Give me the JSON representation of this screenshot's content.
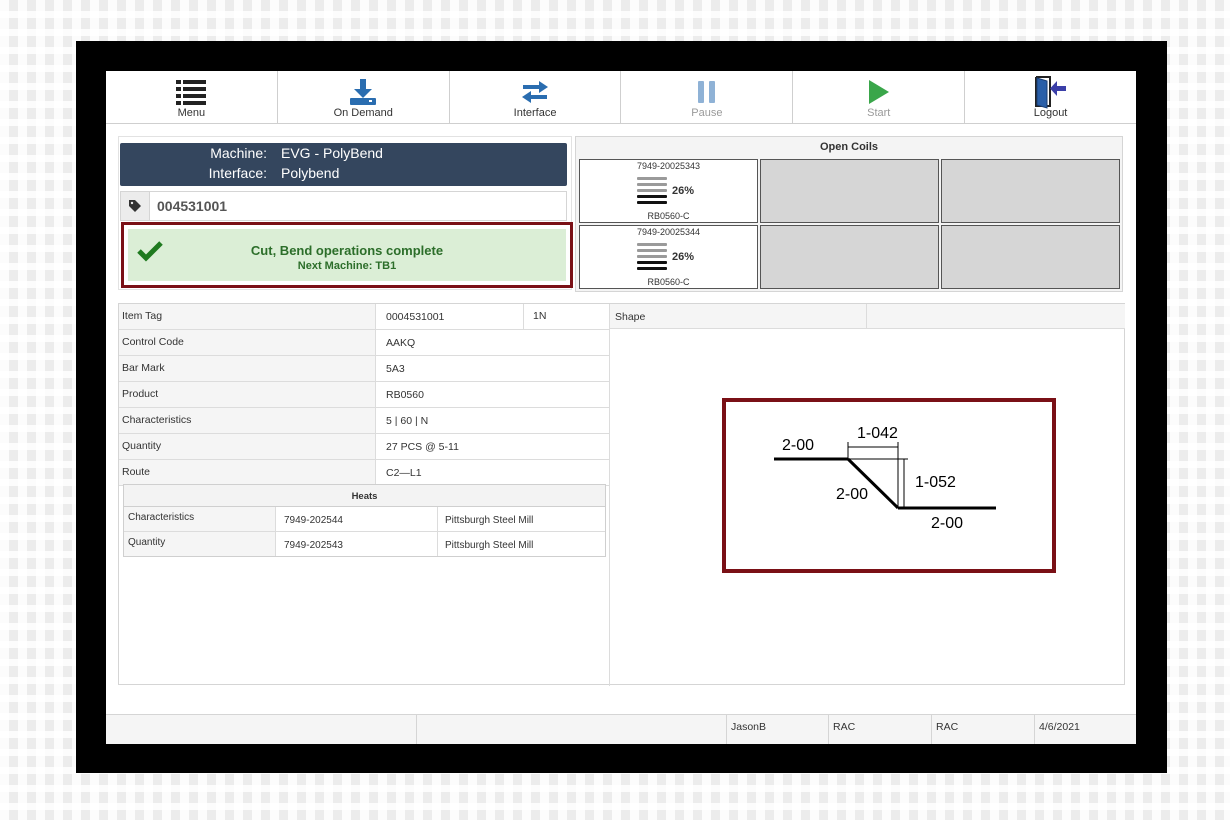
{
  "toolbar": {
    "menu": "Menu",
    "on_demand": "On Demand",
    "interface": "Interface",
    "pause": "Pause",
    "start": "Start",
    "logout": "Logout"
  },
  "machine": {
    "machine_label": "Machine:",
    "machine_value": "EVG - PolyBend",
    "interface_label": "Interface:",
    "interface_value": "Polybend"
  },
  "tag_number": "004531001",
  "status": {
    "title": "Cut, Bend operations complete",
    "subtitle": "Next Machine: TB1",
    "color": "#2c6e2a"
  },
  "open_coils": {
    "title": "Open Coils",
    "coils": [
      {
        "id": "7949-20025343",
        "percent": "26%",
        "product": "RB0560-C"
      },
      {
        "id": "7949-20025344",
        "percent": "26%",
        "product": "RB0560-C"
      }
    ]
  },
  "details": {
    "rows": [
      {
        "label": "Item Tag",
        "value": "0004531001",
        "extra": "1N"
      },
      {
        "label": "Control Code",
        "value": "AAKQ"
      },
      {
        "label": "Bar Mark",
        "value": "5A3"
      },
      {
        "label": "Product",
        "value": "RB0560"
      },
      {
        "label": "Characteristics",
        "value": "5 | 60 | N"
      },
      {
        "label": "Quantity",
        "value": "27 PCS @ 5-11"
      },
      {
        "label": "Route",
        "value": "C2—L1"
      }
    ],
    "shape_label": "Shape"
  },
  "heats": {
    "title": "Heats",
    "rows": [
      {
        "label": "Characteristics",
        "heat": "7949-202544",
        "mill": "Pittsburgh Steel Mill"
      },
      {
        "label": "Quantity",
        "heat": "7949-202543",
        "mill": "Pittsburgh Steel Mill"
      }
    ]
  },
  "shape": {
    "dim_left": "2-00",
    "dim_top": "1-042",
    "dim_right_vertical": "1-052",
    "dim_diagonal": "2-00",
    "dim_bottom": "2-00"
  },
  "footer": {
    "user": "JasonB",
    "field1": "RAC",
    "field2": "RAC",
    "date": "4/6/2021"
  },
  "colors": {
    "header_bg": "#34465e",
    "highlight_border": "#7a1016",
    "blue_icon": "#2a6db0",
    "green_icon": "#3aa64a"
  }
}
